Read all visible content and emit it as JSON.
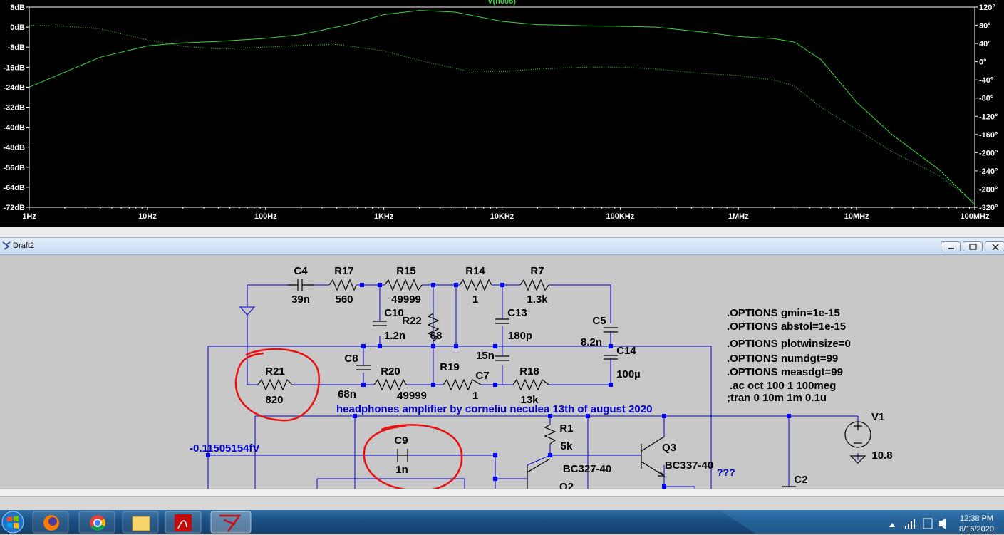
{
  "plot": {
    "title": "V(n006)",
    "colors": {
      "background": "#000000",
      "trace": "#3fd43f",
      "axis": "#ffffff"
    },
    "left_ticks": [
      "8dB",
      "0dB",
      "-8dB",
      "-16dB",
      "-24dB",
      "-32dB",
      "-40dB",
      "-48dB",
      "-56dB",
      "-64dB",
      "-72dB"
    ],
    "right_ticks": [
      "120°",
      "80°",
      "40°",
      "0°",
      "-40°",
      "-80°",
      "-120°",
      "-160°",
      "-200°",
      "-240°",
      "-280°",
      "-320°"
    ],
    "x_ticks": [
      "1Hz",
      "10Hz",
      "100Hz",
      "1KHz",
      "10KHz",
      "100KHz",
      "1MHz",
      "10MHz",
      "100MHz"
    ]
  },
  "chart_data": {
    "type": "line",
    "xlabel": "",
    "ylabel": "",
    "x_scale": "log",
    "xlim_hz": [
      1,
      100000000
    ],
    "ylim_db": [
      -72,
      8
    ],
    "ylim_deg": [
      -320,
      120
    ],
    "series": [
      {
        "style": "solid",
        "axis": "left",
        "x": [
          1,
          2,
          4,
          10,
          20,
          40,
          100,
          200,
          500,
          1000,
          2000,
          4000,
          10000,
          20000,
          50000,
          100000,
          200000,
          500000,
          1000000,
          2000000,
          3000000,
          5000000,
          10000000,
          20000000,
          50000000,
          100000000
        ],
        "y": [
          -24,
          -18,
          -12,
          -7.5,
          -6.3,
          -5.7,
          -4.5,
          -3,
          1,
          5,
          6.7,
          6,
          2.3,
          1,
          0.5,
          0.3,
          0,
          -2,
          -3.8,
          -4.6,
          -6,
          -13,
          -30,
          -43,
          -57,
          -71
        ]
      },
      {
        "style": "dotted",
        "axis": "right",
        "x": [
          1,
          2,
          4,
          10,
          20,
          40,
          100,
          200,
          400,
          1000,
          2000,
          5000,
          10000,
          20000,
          50000,
          100000,
          200000,
          500000,
          1000000,
          2000000,
          3000000,
          5000000,
          10000000,
          20000000,
          50000000,
          100000000
        ],
        "y": [
          80,
          78,
          72,
          48,
          34,
          28,
          32,
          36,
          38,
          24,
          3,
          -20,
          -22,
          -16,
          -12,
          -12,
          -16,
          -26,
          -30,
          -40,
          -54,
          -100,
          -148,
          -198,
          -250,
          -310
        ]
      }
    ]
  },
  "window": {
    "title": "Draft2"
  },
  "schematic": {
    "components": [
      {
        "name": "C4",
        "value": "39n"
      },
      {
        "name": "R17",
        "value": "560"
      },
      {
        "name": "R15",
        "value": "49999"
      },
      {
        "name": "R14",
        "value": "1"
      },
      {
        "name": "R7",
        "value": "1.3k"
      },
      {
        "name": "C10",
        "value": "1.2n"
      },
      {
        "name": "R22",
        "value": "68"
      },
      {
        "name": "C13",
        "value": "180p"
      },
      {
        "name": "C5",
        "value": "8.2n"
      },
      {
        "name": "C14",
        "value": "100µ"
      },
      {
        "name": "C8",
        "value": "68n"
      },
      {
        "name": "R20",
        "value": "49999"
      },
      {
        "name": "R19",
        "value": "1"
      },
      {
        "name": "C7",
        "value": "15n"
      },
      {
        "name": "R18",
        "value": "13k"
      },
      {
        "name": "R21",
        "value": "820"
      },
      {
        "name": "C9",
        "value": "1n"
      },
      {
        "name": "R1",
        "value": "5k"
      },
      {
        "name": "Q3",
        "value": "BC337-40"
      },
      {
        "name": "Q2",
        "value": "BC327-40"
      },
      {
        "name": "V1",
        "value": "10.8"
      },
      {
        "name": "C2",
        "value": ""
      }
    ],
    "directives": [
      ".OPTIONS gmin=1e-15",
      ".OPTIONS abstol=1e-15",
      ".OPTIONS plotwinsize=0",
      ".OPTIONS numdgt=99",
      ".OPTIONS measdgt=99",
      ".ac oct 100 1 100meg",
      ";tran 0 10m 1m 0.1u"
    ],
    "comment": "headphones amplifier by corneliu neculea 13th of august 2020",
    "node_voltage": "-0.11505154fV",
    "question_marks": "???",
    "colors": {
      "wire": "#0000cc",
      "label": "#000000",
      "comment": "#0000cc",
      "annotation": "#e81010",
      "junction": "#0000ff"
    }
  },
  "taskbar": {
    "time": "12:38 PM",
    "date": "8/16/2020",
    "apps": [
      "start-orb",
      "firefox",
      "chrome",
      "file-explorer",
      "acrobat",
      "ltspice"
    ]
  }
}
